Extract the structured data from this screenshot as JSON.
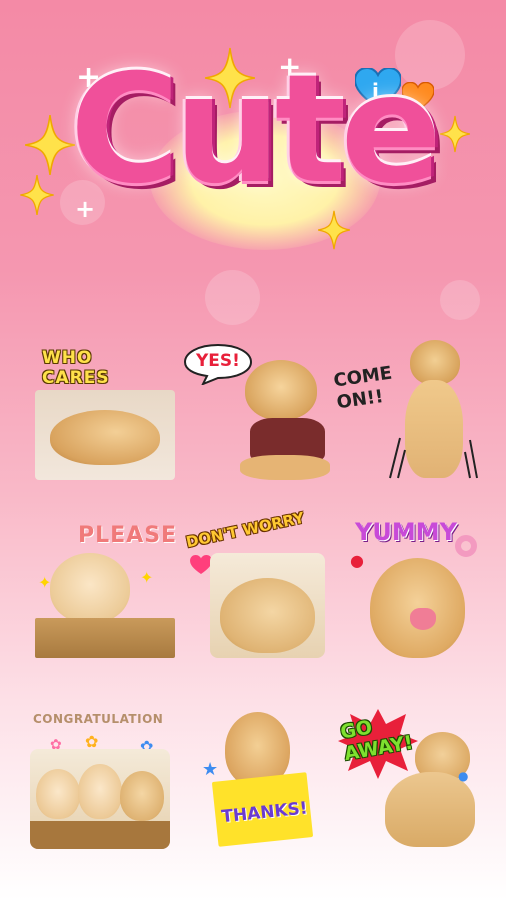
{
  "header": {
    "title": "Cute"
  },
  "colors": {
    "accent": "#f0509a",
    "background_top": "#f48aa6",
    "background_bottom": "#ffffff"
  },
  "stickers": [
    {
      "caption": "WHO CARES",
      "icon": "puppy-lying"
    },
    {
      "caption": "YES!",
      "icon": "puppy-shirt"
    },
    {
      "caption": "COME ON!!",
      "icon": "puppy-standing"
    },
    {
      "caption": "PLEASE",
      "icon": "puppy-crying"
    },
    {
      "caption": "DON'T WORRY",
      "icon": "puppies-hugging"
    },
    {
      "caption": "YUMMY",
      "icon": "puppy-licking"
    },
    {
      "caption": "CONGRATULATION",
      "icon": "three-puppies"
    },
    {
      "caption": "THANKS!",
      "icon": "puppy-sign"
    },
    {
      "caption": "GO AWAY!",
      "icon": "puppy-sad"
    }
  ]
}
